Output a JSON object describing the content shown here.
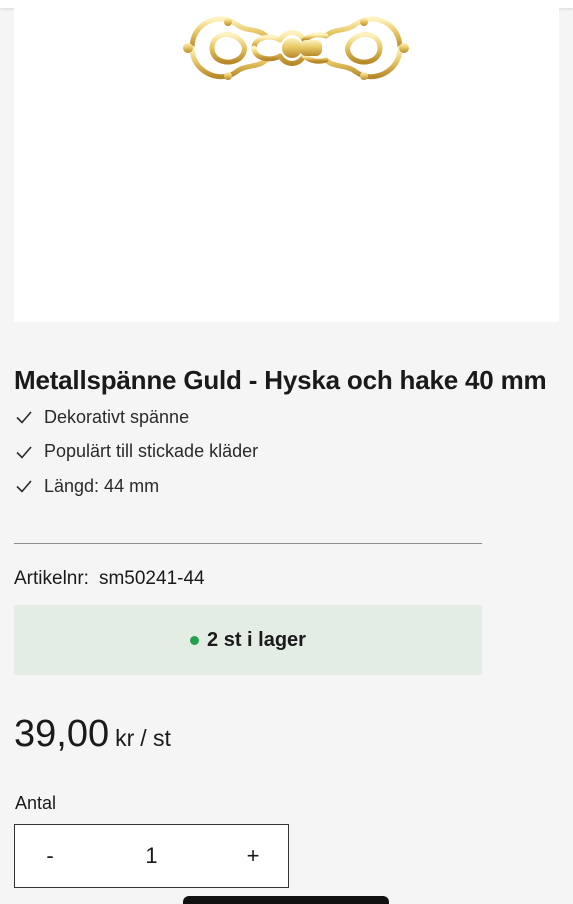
{
  "product": {
    "image_alt": "Metallspänne guld",
    "title": "Metallspänne Guld - Hyska och hake 40 mm",
    "features": [
      {
        "icon": "check-icon",
        "text": "Dekorativt spänne"
      },
      {
        "icon": "check-icon",
        "text": "Populärt till stickade kläder"
      },
      {
        "icon": "check-icon",
        "text": "Längd: 44 mm"
      }
    ],
    "sku_label": "Artikelnr:",
    "sku_value": "sm50241-44",
    "stock_text": "2 st i lager",
    "stock_color": "#22a14a",
    "price_amount": "39,00",
    "price_currency": "kr",
    "price_unit": "/ st",
    "quantity_label": "Antal",
    "quantity_value": "1",
    "decrement_label": "-",
    "increment_label": "+"
  },
  "colors": {
    "background": "#f5f5f5",
    "stock_bg": "#e3ede4",
    "gold": "#e2bd5a"
  }
}
